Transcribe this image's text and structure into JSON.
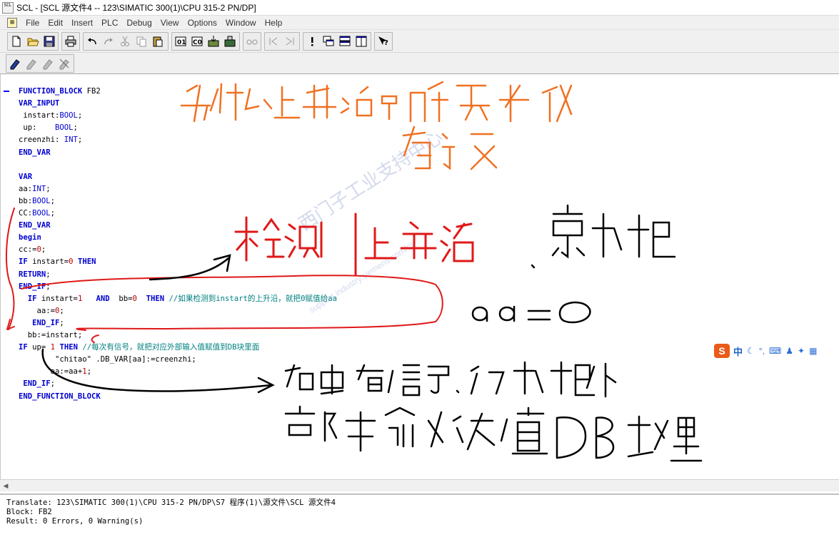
{
  "window": {
    "title": "SCL  - [SCL 源文件4 -- 123\\SIMATIC 300(1)\\CPU 315-2 PN/DP]",
    "icon_text": "SCL"
  },
  "menubar": {
    "doc_icon": "document-icon",
    "items": [
      "File",
      "Edit",
      "Insert",
      "PLC",
      "Debug",
      "View",
      "Options",
      "Window",
      "Help"
    ]
  },
  "toolbar": {
    "buttons": [
      {
        "name": "new-file-icon"
      },
      {
        "name": "open-folder-icon"
      },
      {
        "name": "save-icon"
      },
      {
        "name": "print-icon"
      },
      {
        "name": "undo-icon"
      },
      {
        "name": "redo-icon"
      },
      {
        "name": "cut-icon"
      },
      {
        "name": "copy-icon"
      },
      {
        "name": "paste-icon"
      },
      {
        "name": "compile-icon"
      },
      {
        "name": "compile-all-icon"
      },
      {
        "name": "download-icon"
      },
      {
        "name": "monitor-icon"
      },
      {
        "name": "glasses-icon"
      },
      {
        "name": "prev-error-icon"
      },
      {
        "name": "next-error-icon"
      },
      {
        "name": "exclamation-icon"
      },
      {
        "name": "cascade-windows-icon"
      },
      {
        "name": "tile-horizontal-icon"
      },
      {
        "name": "tile-vertical-icon"
      },
      {
        "name": "context-help-icon"
      }
    ],
    "breakpoint_buttons": [
      {
        "name": "breakpoint-icon"
      },
      {
        "name": "step-icon"
      },
      {
        "name": "step-into-icon"
      },
      {
        "name": "step-out-icon"
      }
    ]
  },
  "code": {
    "lines": [
      [
        {
          "t": "FUNCTION_BLOCK",
          "c": "kw"
        },
        {
          "t": " FB2",
          "c": "pl"
        }
      ],
      [
        {
          "t": "VAR_INPUT",
          "c": "kw"
        }
      ],
      [
        {
          "t": " instart:",
          "c": "pl"
        },
        {
          "t": "BOOL",
          "c": "typ"
        },
        {
          "t": ";",
          "c": "pl"
        }
      ],
      [
        {
          "t": " up:    ",
          "c": "pl"
        },
        {
          "t": "BOOL",
          "c": "typ"
        },
        {
          "t": ";",
          "c": "pl"
        }
      ],
      [
        {
          "t": "creenzhi: ",
          "c": "pl"
        },
        {
          "t": "INT",
          "c": "typ"
        },
        {
          "t": ";",
          "c": "pl"
        }
      ],
      [
        {
          "t": "END_VAR",
          "c": "kw"
        }
      ],
      [],
      [
        {
          "t": "VAR",
          "c": "kw"
        }
      ],
      [
        {
          "t": "aa:",
          "c": "pl"
        },
        {
          "t": "INT",
          "c": "typ"
        },
        {
          "t": ";",
          "c": "pl"
        }
      ],
      [
        {
          "t": "bb:",
          "c": "pl"
        },
        {
          "t": "BOOL",
          "c": "typ"
        },
        {
          "t": ";",
          "c": "pl"
        }
      ],
      [
        {
          "t": "CC:",
          "c": "pl"
        },
        {
          "t": "BOOL",
          "c": "typ"
        },
        {
          "t": ";",
          "c": "pl"
        }
      ],
      [
        {
          "t": "END_VAR",
          "c": "kw"
        }
      ],
      [
        {
          "t": "begin",
          "c": "kw"
        }
      ],
      [
        {
          "t": "cc:=",
          "c": "pl"
        },
        {
          "t": "0",
          "c": "num"
        },
        {
          "t": ";",
          "c": "pl"
        }
      ],
      [
        {
          "t": "IF",
          "c": "kw"
        },
        {
          "t": " instart=",
          "c": "pl"
        },
        {
          "t": "0",
          "c": "num"
        },
        {
          "t": " ",
          "c": "pl"
        },
        {
          "t": "THEN",
          "c": "kw"
        }
      ],
      [
        {
          "t": "RETURN",
          "c": "kw"
        },
        {
          "t": ";",
          "c": "pl"
        }
      ],
      [
        {
          "t": "END_IF",
          "c": "kw"
        },
        {
          "t": ";",
          "c": "pl"
        }
      ],
      [
        {
          "t": "  ",
          "c": "pl"
        },
        {
          "t": "IF",
          "c": "kw"
        },
        {
          "t": " instart=",
          "c": "pl"
        },
        {
          "t": "1",
          "c": "num"
        },
        {
          "t": "   ",
          "c": "pl"
        },
        {
          "t": "AND",
          "c": "kw"
        },
        {
          "t": "  bb=",
          "c": "pl"
        },
        {
          "t": "0",
          "c": "num"
        },
        {
          "t": "  ",
          "c": "pl"
        },
        {
          "t": "THEN",
          "c": "kw"
        },
        {
          "t": " //如果检测到instart的上升沿，就把0赋值给aa",
          "c": "cm"
        }
      ],
      [
        {
          "t": "    aa:=",
          "c": "pl"
        },
        {
          "t": "0",
          "c": "num"
        },
        {
          "t": ";",
          "c": "pl"
        }
      ],
      [
        {
          "t": "   ",
          "c": "pl"
        },
        {
          "t": "END_IF",
          "c": "kw"
        },
        {
          "t": ";",
          "c": "pl"
        }
      ],
      [
        {
          "t": "  bb:=instart;",
          "c": "pl"
        }
      ],
      [
        {
          "t": "IF",
          "c": "kw"
        },
        {
          "t": " up= ",
          "c": "pl"
        },
        {
          "t": "1",
          "c": "num"
        },
        {
          "t": " ",
          "c": "pl"
        },
        {
          "t": "THEN",
          "c": "kw"
        },
        {
          "t": " //每次有信号，就把对应外部输入值赋值到DB块里面",
          "c": "cm"
        }
      ],
      [
        {
          "t": "        \"chitao\" .DB_VAR[aa]:=creenzhi;",
          "c": "pl"
        }
      ],
      [
        {
          "t": "       aa:=aa+",
          "c": "pl"
        },
        {
          "t": "1",
          "c": "num"
        },
        {
          "t": ";",
          "c": "pl"
        }
      ],
      [
        {
          "t": " ",
          "c": "pl"
        },
        {
          "t": "END_IF",
          "c": "kw"
        },
        {
          "t": ";",
          "c": "pl"
        }
      ],
      [
        {
          "t": "END_FUNCTION_BLOCK",
          "c": "kw"
        }
      ]
    ]
  },
  "output": {
    "lines": [
      "Translate: 123\\SIMATIC 300(1)\\CPU 315-2 PN/DP\\S7 程序(1)\\源文件\\SCL 源文件4",
      "Block: FB2",
      "Result: 0 Errors, 0 Warning(s)"
    ]
  },
  "ime": {
    "logo": "S",
    "lang": "中",
    "icons": [
      "moon-icon",
      "punctuation-icon",
      "keyboard-icon",
      "user-icon",
      "shirt-icon",
      "grid-icon"
    ]
  },
  "watermark": {
    "text": "西门子工业支持中心",
    "sub": "support.industry.siemens.com/cs"
  },
  "colors": {
    "keyword": "#0000d0",
    "comment": "#008080",
    "number": "#c00000",
    "annotation_orange": "#f07020",
    "annotation_red": "#e01818",
    "annotation_black": "#000000"
  }
}
